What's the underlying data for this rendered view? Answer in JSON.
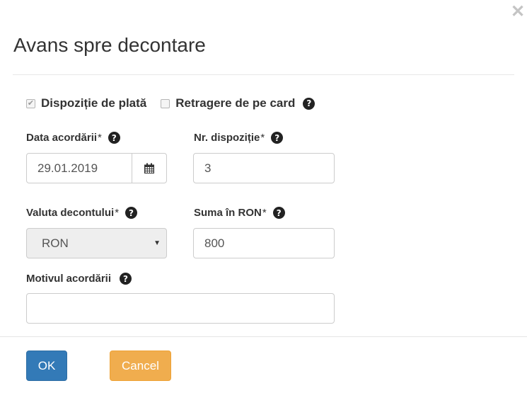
{
  "dialog": {
    "title": "Avans spre decontare",
    "close_glyph": "✕"
  },
  "checkboxes": {
    "dispozitie": {
      "label": "Dispoziție de plată",
      "checked": true
    },
    "retragere": {
      "label": "Retragere de pe card",
      "checked": false
    }
  },
  "fields": {
    "data_acordarii": {
      "label": "Data acordării",
      "required_mark": "*",
      "value": "29.01.2019"
    },
    "nr_dispozitie": {
      "label": "Nr. dispoziție",
      "required_mark": "*",
      "value": "3"
    },
    "valuta_decontului": {
      "label": "Valuta decontului",
      "required_mark": "*",
      "value": "RON"
    },
    "suma": {
      "label": "Suma în RON",
      "required_mark": "*",
      "value": "800"
    },
    "motivul_acordarii": {
      "label": "Motivul acordării",
      "value": ""
    }
  },
  "icons": {
    "help": "question-circle-icon",
    "calendar": "calendar-icon",
    "help_glyph": "?",
    "caret_glyph": "▼"
  },
  "buttons": {
    "ok": "OK",
    "cancel": "Cancel"
  },
  "colors": {
    "primary": "#337ab7",
    "warning": "#f0ad4e"
  }
}
